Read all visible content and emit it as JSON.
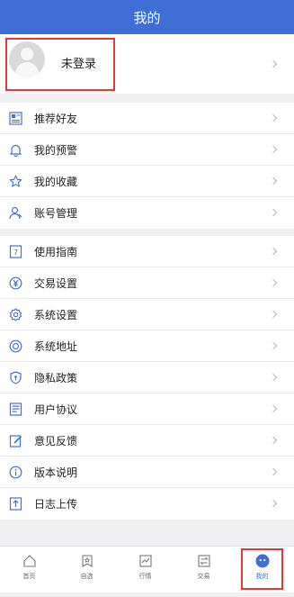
{
  "header": {
    "title": "我的"
  },
  "profile": {
    "name": "未登录"
  },
  "group1": [
    {
      "label": "推荐好友",
      "icon": "recommend-icon"
    },
    {
      "label": "我的预警",
      "icon": "bell-icon"
    },
    {
      "label": "我的收藏",
      "icon": "star-icon"
    },
    {
      "label": "账号管理",
      "icon": "user-icon"
    }
  ],
  "group2": [
    {
      "label": "使用指南",
      "icon": "guide-icon"
    },
    {
      "label": "交易设置",
      "icon": "yen-icon"
    },
    {
      "label": "系统设置",
      "icon": "gear-icon"
    },
    {
      "label": "系统地址",
      "icon": "target-icon"
    },
    {
      "label": "隐私政策",
      "icon": "shield-icon"
    },
    {
      "label": "用户协议",
      "icon": "agreement-icon"
    },
    {
      "label": "意见反馈",
      "icon": "feedback-icon"
    },
    {
      "label": "版本说明",
      "icon": "info-icon"
    },
    {
      "label": "日志上传",
      "icon": "upload-icon"
    }
  ],
  "tabs": [
    {
      "label": "首页",
      "icon": "home-icon"
    },
    {
      "label": "自选",
      "icon": "watchlist-icon"
    },
    {
      "label": "行情",
      "icon": "chart-icon"
    },
    {
      "label": "交易",
      "icon": "trade-icon"
    },
    {
      "label": "我的",
      "icon": "profile-icon",
      "active": true
    }
  ],
  "colors": {
    "primary": "#3f6fd6",
    "highlight_border": "#e23a3a"
  }
}
